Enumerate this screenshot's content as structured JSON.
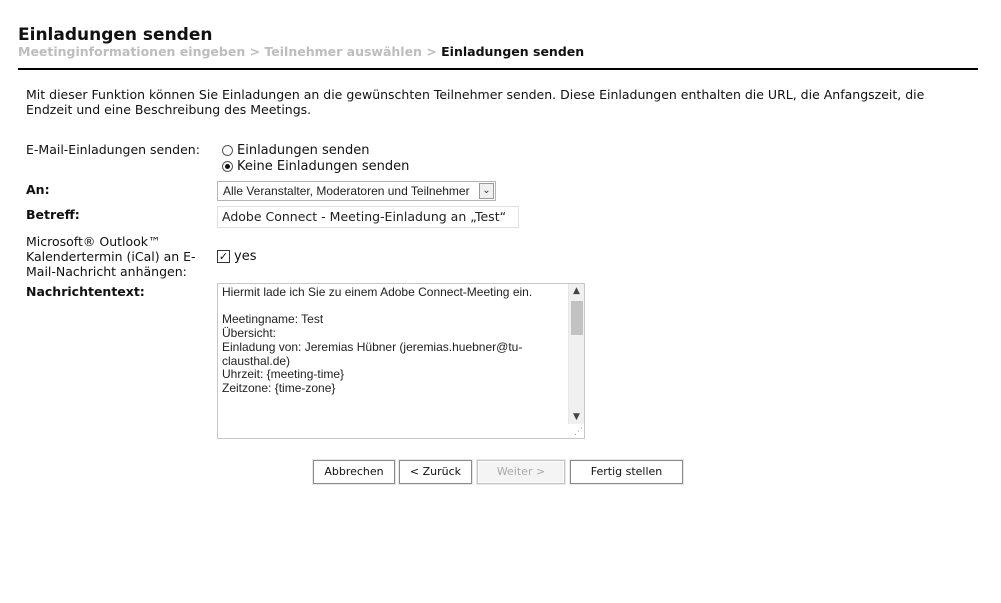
{
  "header": {
    "title": "Einladungen senden",
    "breadcrumb": {
      "step1": "Meetinginformationen eingeben",
      "sep1": " > ",
      "step2": "Teilnehmer auswählen",
      "sep2": " > ",
      "step3": "Einladungen senden"
    }
  },
  "intro": "Mit dieser Funktion können Sie Einladungen an die gewünschten Teilnehmer senden. Diese Einladungen enthalten die URL, die Anfangszeit, die Endzeit und eine Beschreibung des Meetings.",
  "form": {
    "email_label": "E-Mail-Einladungen senden:",
    "radio_send": {
      "label": "Einladungen senden",
      "selected": false
    },
    "radio_none": {
      "label": "Keine Einladungen senden",
      "selected": true
    },
    "to_label": "An:",
    "to_value": "Alle Veranstalter, Moderatoren und Teilnehmer",
    "subject_label": "Betreff:",
    "subject_value": "Adobe Connect - Meeting-Einladung an „Test“",
    "ical_label": "Microsoft® Outlook™ Kalendertermin (iCal) an E-Mail-Nachricht anhängen:",
    "ical_checked": true,
    "ical_text": "yes",
    "message_label": "Nachrichtentext:",
    "message_text": "Hiermit lade ich Sie zu einem Adobe Connect-Meeting ein.\n\nMeetingname: Test\nÜbersicht:\nEinladung von: Jeremias Hübner (jeremias.huebner@tu-clausthal.de)\nUhrzeit: {meeting-time}\nZeitzone: {time-zone}\n\n\n\nZur Teilnahme am Meeting:"
  },
  "buttons": {
    "cancel": "Abbrechen",
    "back": "< Zurück",
    "next": "Weiter >",
    "finish": "Fertig stellen"
  },
  "icons": {
    "select_arrow": "chevron-down-icon",
    "check": "checkmark-icon"
  }
}
